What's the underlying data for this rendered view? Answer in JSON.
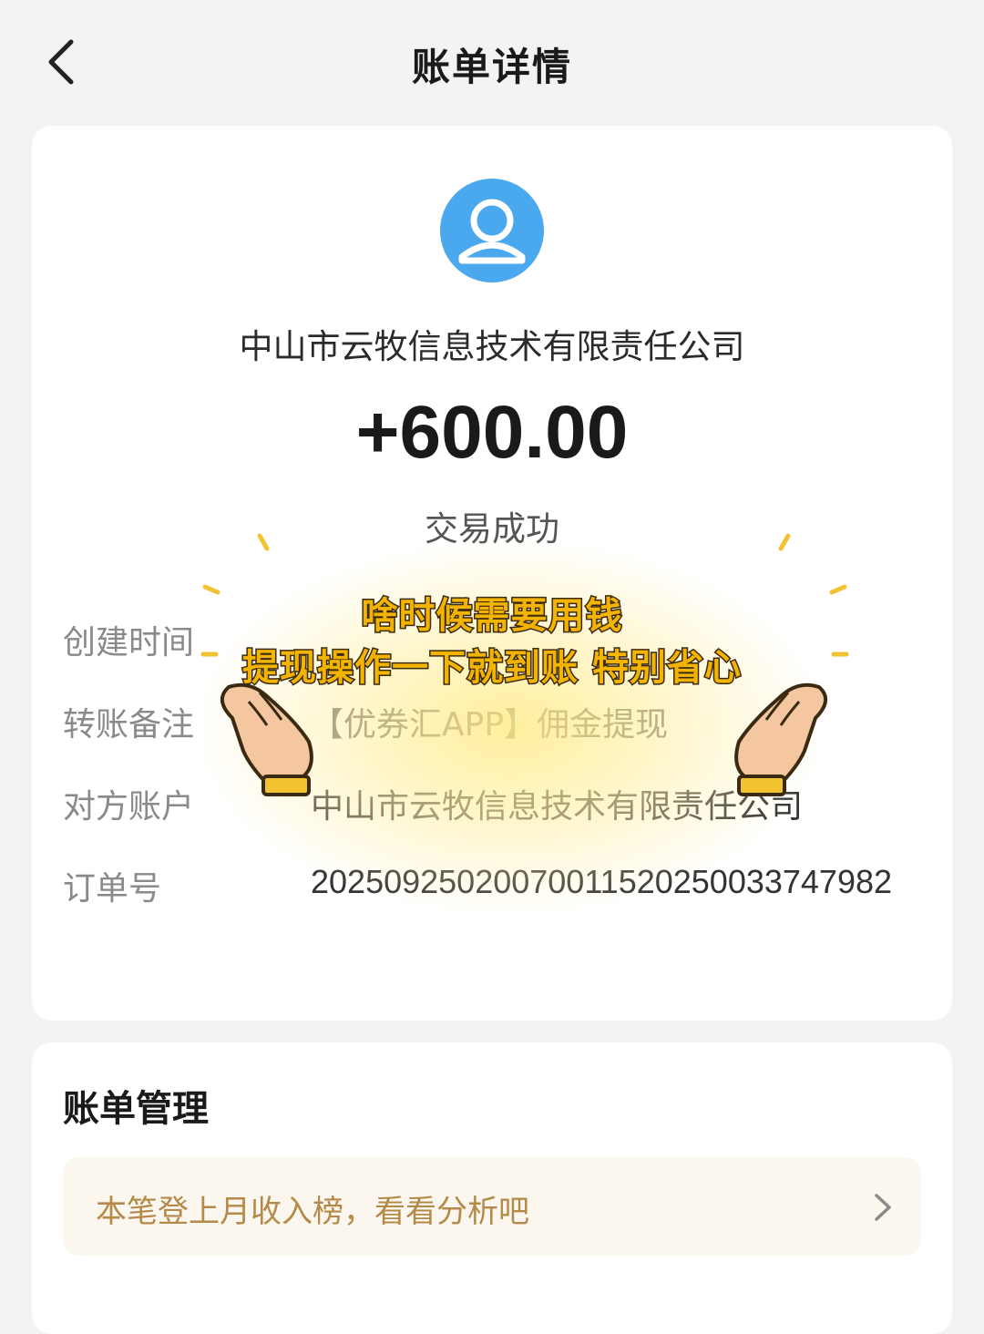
{
  "header": {
    "title": "账单详情"
  },
  "bill": {
    "merchant": "中山市云牧信息技术有限责任公司",
    "amount": "+600.00",
    "status": "交易成功"
  },
  "details": {
    "created_label": "创建时间",
    "remark_label": "转账备注",
    "remark_value": "【优券汇APP】佣金提现",
    "counterparty_label": "对方账户",
    "counterparty_value": "中山市云牧信息技术有限责任公司",
    "order_label": "订单号",
    "order_value": "20250925020070011520250033747982"
  },
  "sticker": {
    "line1": "啥时候需要用钱",
    "line2": "提现操作一下就到账 特别省心"
  },
  "manage": {
    "title": "账单管理",
    "insight_text": "本笔登上月收入榜，看看分析吧"
  },
  "colors": {
    "avatar_blue": "#4aa8ee",
    "insight_text": "#b48a4a",
    "insight_bg": "#fbf6ee",
    "sticker_yellow": "#f2b400"
  },
  "icons": {
    "back": "chevron-left-icon",
    "avatar": "user-avatar-icon",
    "chevron": "chevron-right-icon",
    "hands": "cupped-hands-icon"
  }
}
